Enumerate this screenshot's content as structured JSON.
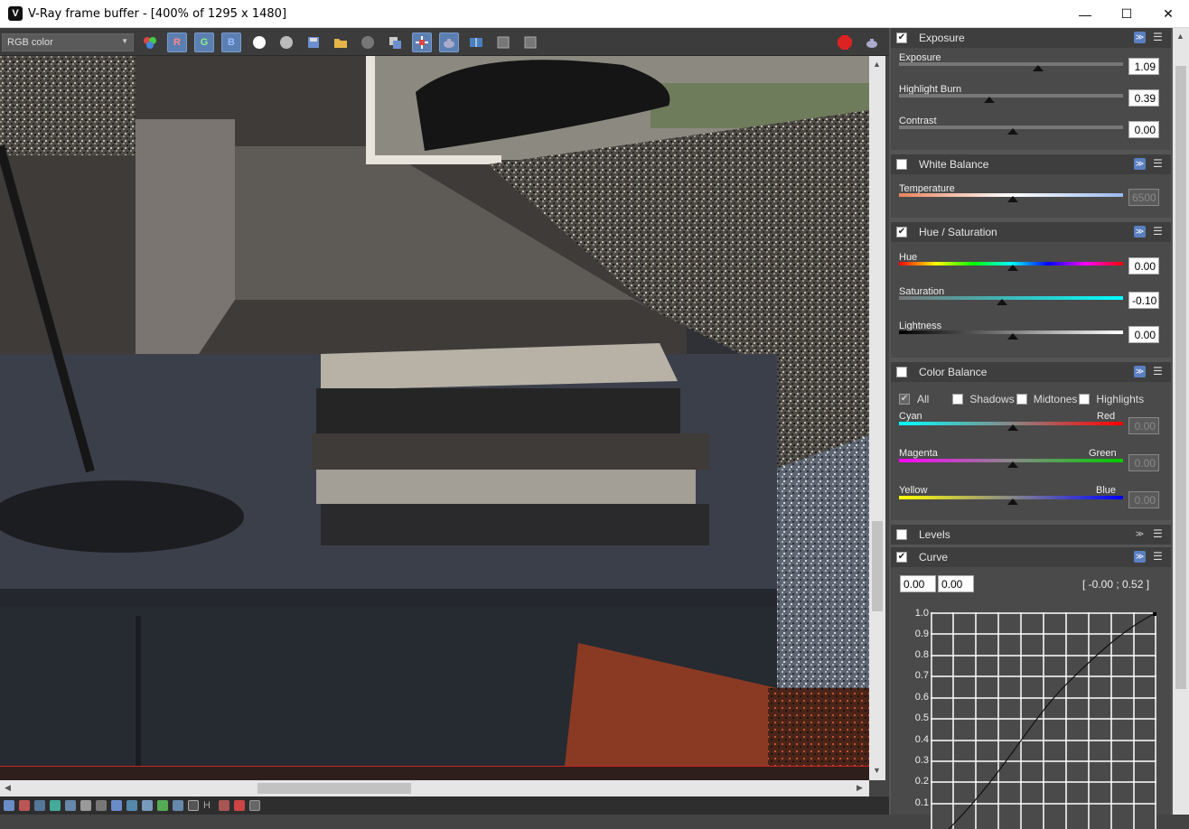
{
  "window": {
    "title": "V-Ray frame buffer - [400% of 1295 x 1480]",
    "minimize": "—",
    "maximize": "☐",
    "close": "✕"
  },
  "toolbar": {
    "channel": "RGB color",
    "buttons": [
      "R",
      "G",
      "B"
    ]
  },
  "exposure": {
    "title": "Exposure",
    "rows": [
      {
        "label": "Exposure",
        "value": "1.09",
        "level": 0.6
      },
      {
        "label": "Highlight Burn",
        "value": "0.39",
        "level": 0.39
      },
      {
        "label": "Contrast",
        "value": "0.00",
        "level": 0.5
      }
    ]
  },
  "white_balance": {
    "title": "White Balance",
    "label": "Temperature",
    "value": "6500",
    "level": 0.5
  },
  "hue_sat": {
    "title": "Hue / Saturation",
    "rows": [
      {
        "label": "Hue",
        "value": "0.00",
        "level": 0.5
      },
      {
        "label": "Saturation",
        "value": "-0.10",
        "level": 0.45
      },
      {
        "label": "Lightness",
        "value": "0.00",
        "level": 0.5
      }
    ]
  },
  "color_balance": {
    "title": "Color Balance",
    "options": [
      "All",
      "Shadows",
      "Midtones",
      "Highlights"
    ],
    "rows": [
      {
        "left": "Cyan",
        "right": "Red",
        "value": "0.00",
        "level": 0.5
      },
      {
        "left": "Magenta",
        "right": "Green",
        "value": "0.00",
        "level": 0.5
      },
      {
        "left": "Yellow",
        "right": "Blue",
        "value": "0.00",
        "level": 0.5
      }
    ]
  },
  "levels": {
    "title": "Levels"
  },
  "curve": {
    "title": "Curve",
    "input_x": "0.00",
    "input_y": "0.00",
    "readout": "[ -0.00 ; 0.52 ]",
    "y_ticks": [
      "1.0",
      "0.9",
      "0.8",
      "0.7",
      "0.6",
      "0.5",
      "0.4",
      "0.3",
      "0.2",
      "0.1"
    ]
  },
  "colors": {
    "accent": "#5c7fb2",
    "panel_bg": "#4a4a4a",
    "header_bg": "#3e3e3e"
  }
}
